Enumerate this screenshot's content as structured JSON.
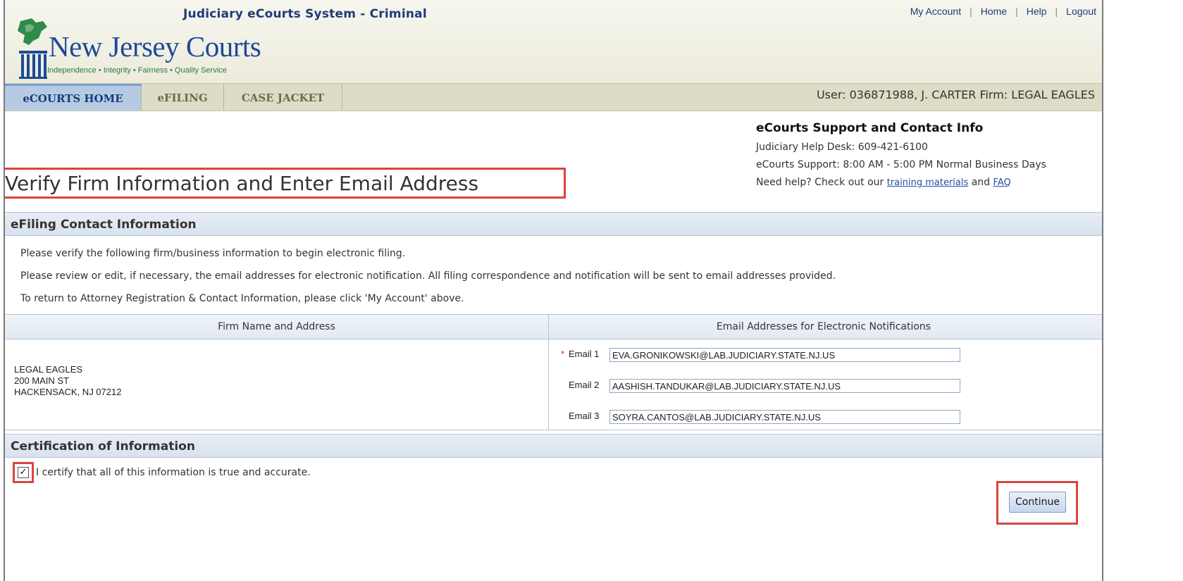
{
  "header": {
    "system_title": "Judiciary eCourts System - Criminal",
    "links": [
      "My Account",
      "Home",
      "Help",
      "Logout"
    ],
    "logo_name": "New Jersey Courts",
    "logo_tagline": "Independence • Integrity • Fairness • Quality Service"
  },
  "nav": {
    "tabs": [
      "eCOURTS HOME",
      "eFILING",
      "CASE JACKET"
    ],
    "active_tab": "eCOURTS HOME",
    "user_info": "User: 036871988, J. CARTER  Firm: LEGAL EAGLES"
  },
  "page": {
    "title": "Verify Firm Information and Enter Email Address"
  },
  "support": {
    "title": "eCourts Support and Contact Info",
    "help_desk": "Judiciary Help Desk: 609-421-6100",
    "hours": "eCourts Support: 8:00 AM - 5:00 PM Normal Business Days",
    "help_prefix": "Need help? Check out our",
    "training_link": "training materials",
    "and_text": "and",
    "faq_link": "FAQ"
  },
  "contact_section": {
    "heading": "eFiling Contact Information",
    "instructions": [
      "Please verify the following firm/business information to begin electronic filing.",
      "Please review or edit, if necessary, the email addresses for electronic notification. All filing correspondence and notification will be sent to email addresses provided.",
      "To return to Attorney Registration & Contact Information, please click 'My Account' above."
    ]
  },
  "table": {
    "col_firm": "Firm Name and Address",
    "col_emails": "Email Addresses for Electronic Notifications",
    "firm_lines": [
      "LEGAL EAGLES",
      "200 MAIN ST",
      "HACKENSACK, NJ 07212"
    ],
    "emails": [
      {
        "label": "Email 1",
        "required": "*",
        "value": "EVA.GRONIKOWSKI@LAB.JUDICIARY.STATE.NJ.US"
      },
      {
        "label": "Email 2",
        "required": "",
        "value": "AASHISH.TANDUKAR@LAB.JUDICIARY.STATE.NJ.US"
      },
      {
        "label": "Email 3",
        "required": "",
        "value": "SOYRA.CANTOS@LAB.JUDICIARY.STATE.NJ.US"
      }
    ]
  },
  "certification": {
    "heading": "Certification of Information",
    "checkbox_mark": "✓",
    "text": "I certify that all of this information is true and accurate.",
    "checked": true
  },
  "actions": {
    "continue_label": "Continue"
  },
  "colors": {
    "highlight": "#d9453f",
    "brand_blue": "#1d4a96",
    "tagline_green": "#2c7a45"
  }
}
